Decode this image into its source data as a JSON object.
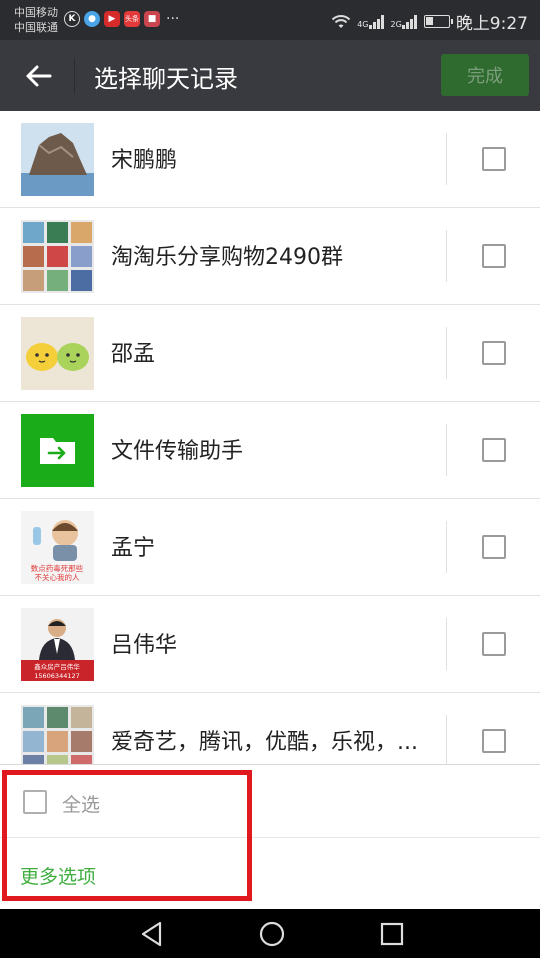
{
  "status_bar": {
    "carrier_1": "中国移动",
    "carrier_2": "中国联通",
    "net_4g": "4G",
    "net_2g": "2G",
    "time": "晚上9:27",
    "battery_level": 0.35,
    "notification_icons": [
      "k-icon",
      "browser-icon",
      "video-icon",
      "toutiao-icon",
      "app-icon"
    ],
    "toutiao_label": "头条",
    "more": "···"
  },
  "header": {
    "title": "选择聊天记录",
    "done_label": "完成"
  },
  "chats": [
    {
      "name": "宋鹏鹏",
      "avatar": "landscape-rock-avatar",
      "checked": false
    },
    {
      "name": "淘淘乐分享购物2490群",
      "avatar": "group-grid-avatar",
      "checked": false
    },
    {
      "name": "邵孟",
      "avatar": "cartoon-faces-avatar",
      "checked": false
    },
    {
      "name": "文件传输助手",
      "avatar": "file-transfer-icon",
      "checked": false
    },
    {
      "name": "孟宁",
      "avatar": "cartoon-doctor-avatar",
      "checked": false,
      "avatar_caption_1": "数点药毒死那些",
      "avatar_caption_2": "不关心我的人"
    },
    {
      "name": "吕伟华",
      "avatar": "businessman-avatar",
      "checked": false,
      "avatar_caption_1": "鑫众房产吕伟华",
      "avatar_caption_2": "15606344127"
    },
    {
      "name": "爱奇艺，腾讯，优酷，乐视，...",
      "avatar": "group-grid-avatar",
      "checked": false
    }
  ],
  "bottom": {
    "select_all_label": "全选",
    "more_options_label": "更多选项"
  },
  "colors": {
    "title_bar": "#393a3f",
    "status_bar": "#2b2c30",
    "done_button": "#2f6b2f",
    "accent_green": "#3fae3f",
    "highlight": "#e0191e"
  }
}
